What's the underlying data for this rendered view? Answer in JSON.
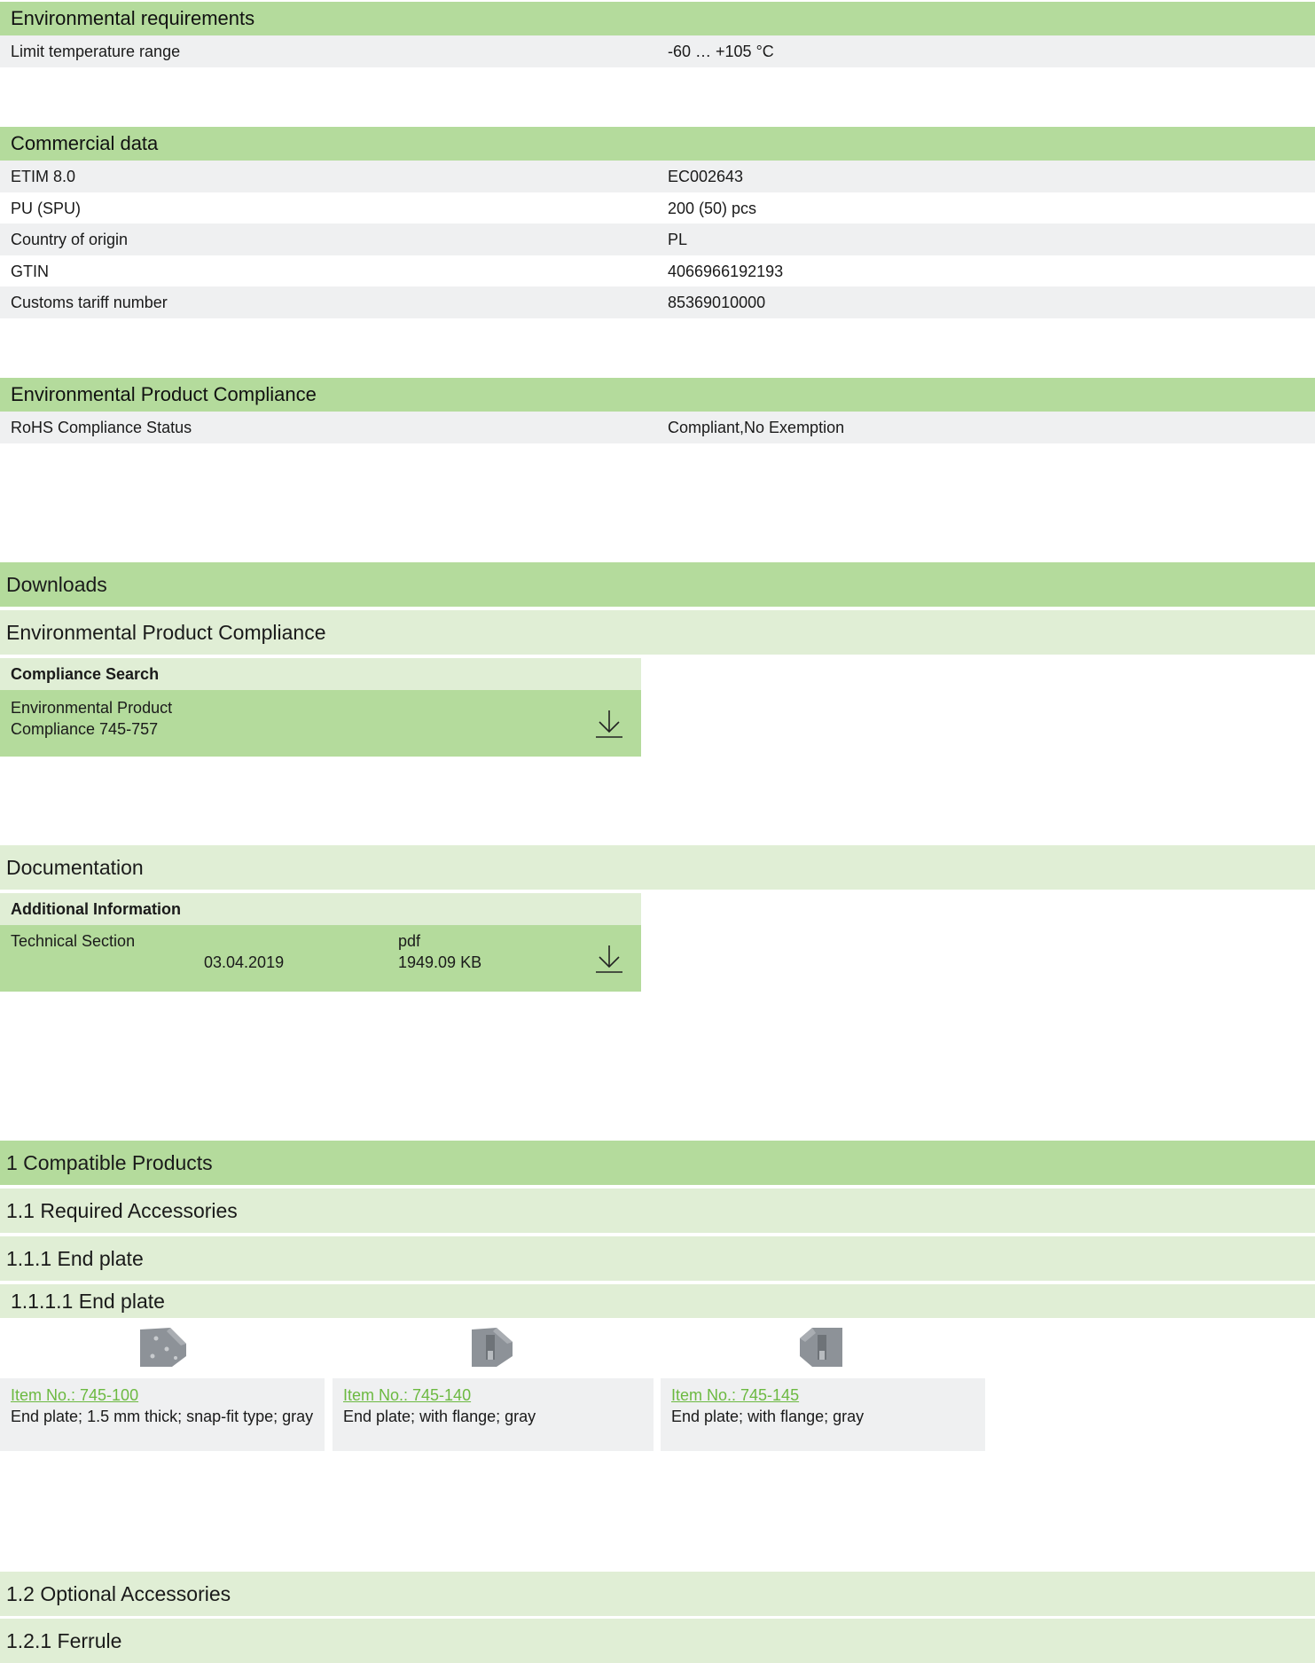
{
  "environmental_requirements": {
    "title": "Environmental requirements",
    "rows": [
      {
        "label": "Limit temperature range",
        "value": "-60 … +105 °C"
      }
    ]
  },
  "commercial_data": {
    "title": "Commercial data",
    "rows": [
      {
        "label": "ETIM 8.0",
        "value": "EC002643"
      },
      {
        "label": "PU (SPU)",
        "value": "200 (50) pcs"
      },
      {
        "label": "Country of origin",
        "value": "PL"
      },
      {
        "label": "GTIN",
        "value": "4066966192193"
      },
      {
        "label": "Customs tariff number",
        "value": "85369010000"
      }
    ]
  },
  "environmental_product_compliance": {
    "title": "Environmental Product Compliance",
    "rows": [
      {
        "label": "RoHS Compliance Status",
        "value": "Compliant,No Exemption"
      }
    ]
  },
  "downloads": {
    "title": "Downloads",
    "compliance": {
      "title": "Environmental Product Compliance",
      "box_header": "Compliance Search",
      "item_line1": "Environmental Product",
      "item_line2": "Compliance 745-757",
      "download_icon": "download-icon"
    },
    "documentation": {
      "title": "Documentation",
      "box_header": "Additional Information",
      "item_name": "Technical Section",
      "item_date": "03.04.2019",
      "item_type": "pdf",
      "item_size": "1949.09 KB",
      "download_icon": "download-icon"
    }
  },
  "compatible_products": {
    "title": "1 Compatible Products",
    "required": {
      "title": "1.1 Required Accessories",
      "group": "1.1.1 End plate",
      "subgroup": "1.1.1.1 End plate",
      "items": [
        {
          "item_no": "Item No.: 745-100",
          "desc": "End plate; 1.5 mm thick; snap-fit type; gray"
        },
        {
          "item_no": "Item No.: 745-140",
          "desc": "End plate; with flange; gray"
        },
        {
          "item_no": "Item No.: 745-145",
          "desc": "End plate; with flange; gray"
        }
      ]
    },
    "optional": {
      "title": "1.2 Optional Accessories",
      "group": "1.2.1 Ferrule"
    }
  },
  "colors": {
    "section_green": "#b4db9c",
    "subsection_green": "#e0eed5",
    "row_shade": "#eff0f1",
    "link_green": "#6cb941"
  }
}
